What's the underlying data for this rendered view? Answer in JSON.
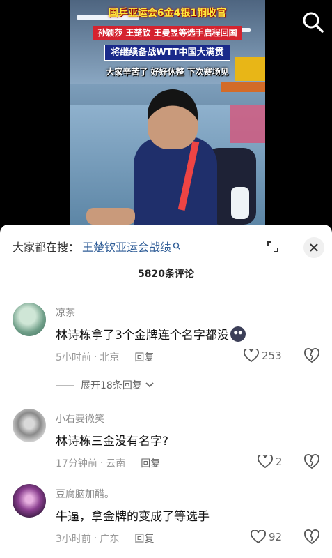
{
  "video": {
    "caption_line1": "国乒亚运会6金4银1铜收官",
    "caption_line2": "孙颖莎 王楚钦 王曼昱等选手启程回国",
    "caption_line3": "将继续备战WTT中国大满贯",
    "caption_line4": "大家辛苦了 好好休整 下次赛场见",
    "search_icon": "search-icon"
  },
  "sheet": {
    "hot_search_prefix": "大家都在搜：",
    "hot_search_term": "王楚钦亚运会战绩",
    "comment_count": "5820条评论",
    "collapse_icon": "collapse-icon",
    "close_icon": "close-icon"
  },
  "comments": [
    {
      "user": "凉茶",
      "text": "林诗栋拿了3个金牌连个名字都没",
      "time": "5小时前",
      "location": "北京",
      "reply_label": "回复",
      "likes": "253",
      "expand_label": "展开18条回复"
    },
    {
      "user": "小右要微笑",
      "text": "林诗栋三金没有名字?",
      "time": "17分钟前",
      "location": "云南",
      "reply_label": "回复",
      "likes": "2"
    },
    {
      "user": "豆腐脑加醋。",
      "text": "牛逼，拿金牌的变成了等选手",
      "time": "3小时前",
      "location": "广东",
      "reply_label": "回复",
      "likes": "92"
    }
  ],
  "colors": {
    "link": "#2f5d97",
    "meta": "#9a9a9a"
  }
}
